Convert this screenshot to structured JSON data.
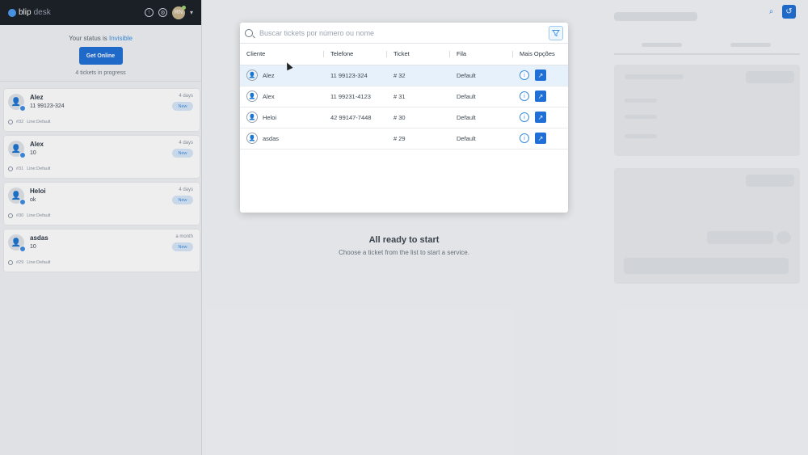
{
  "app": {
    "brand": "blip",
    "brand_suffix": "desk",
    "avatar_initials": "RN"
  },
  "status": {
    "prefix": "Your status is",
    "value": "Invisible",
    "button": "Get Online"
  },
  "tickets_progress": "4 tickets in progress",
  "tickets": [
    {
      "name": "Alez",
      "message": "11 99123-324",
      "time": "4 days",
      "badge": "New",
      "number": "#32",
      "line": "Line:Default"
    },
    {
      "name": "Alex",
      "message": "10",
      "time": "4 days",
      "badge": "New",
      "number": "#31",
      "line": "Line:Default"
    },
    {
      "name": "Heloi",
      "message": "ok",
      "time": "4 days",
      "badge": "New",
      "number": "#30",
      "line": "Line:Default"
    },
    {
      "name": "asdas",
      "message": "10",
      "time": "a month",
      "badge": "New",
      "number": "#29",
      "line": "Line:Default"
    }
  ],
  "center": {
    "title": "All ready to start",
    "subtitle": "Choose a ticket from the list to start a service."
  },
  "modal": {
    "search_placeholder": "Buscar tickets por número ou nome",
    "columns": [
      "Cliente",
      "Telefone",
      "Ticket",
      "Fila",
      "Mais Opções"
    ],
    "rows": [
      {
        "client": "Alez",
        "phone": "11 99123-324",
        "ticket": "# 32",
        "queue": "Default",
        "selected": true
      },
      {
        "client": "Alex",
        "phone": "11 99231-4123",
        "ticket": "# 31",
        "queue": "Default",
        "selected": false
      },
      {
        "client": "Heloi",
        "phone": "42 99147-7448",
        "ticket": "# 30",
        "queue": "Default",
        "selected": false
      },
      {
        "client": "asdas",
        "phone": "",
        "ticket": "# 29",
        "queue": "Default",
        "selected": false
      }
    ]
  },
  "colors": {
    "primary": "#1f6fd6",
    "accent": "#3b8de2",
    "topbar": "#1b1f25",
    "selected_row": "#e6f1fb"
  }
}
